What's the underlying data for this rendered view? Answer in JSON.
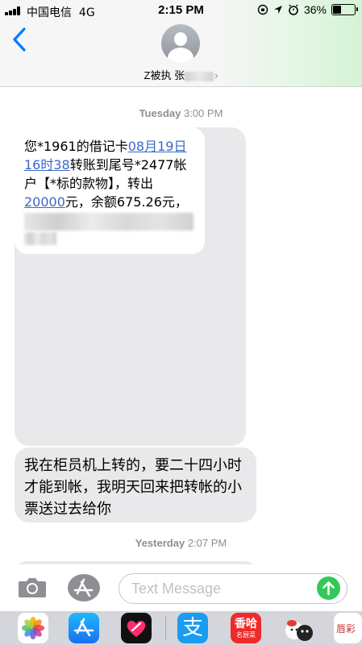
{
  "status_bar": {
    "carrier": "中国电信",
    "network": "4G",
    "time": "2:15 PM",
    "battery_percent": "36%",
    "battery_level": 0.36
  },
  "header": {
    "contact_name": "Z被执 张",
    "avatar_icon": "person-silhouette-icon",
    "back_icon": "chevron-left-icon"
  },
  "messages": {
    "timestamp1": {
      "day": "Tuesday",
      "time": "3:00 PM"
    },
    "bubble1": {
      "line1_prefix": "您*1961的借记卡",
      "link1a": "08月19日",
      "link1b": "16时38",
      "line2_suffix": "转账到尾号*2477帐",
      "line3": "户【*标的款物】，转出",
      "link2": "20000",
      "line4_suffix": "元，余额675.26元，"
    },
    "bubble2": {
      "text": "我在柜员机上转的，要二十四小时才能到帐，我明天回来把转帐的小票送过去给你"
    },
    "timestamp2": {
      "day": "Yesterday",
      "time": "2:07 PM"
    }
  },
  "input_bar": {
    "placeholder": "Text Message",
    "camera_icon": "camera-icon",
    "apps_icon": "app-store-icon",
    "send_icon": "send-arrow-icon"
  },
  "app_drawer": {
    "apps": [
      "photos-icon",
      "app-store-icon",
      "heart-icon",
      "alipay-icon",
      "xianghai-icon",
      "sticker-icon",
      "partial-app-icon"
    ],
    "alipay_label": "支",
    "xianghai_label": "香哈",
    "xianghai_sub": "名厨菜",
    "last_label": "唇彩"
  },
  "colors": {
    "link_blue": "#3a67c7",
    "ios_blue": "#007aff",
    "send_green": "#34c759",
    "bubble_gray": "#e9e9eb"
  }
}
